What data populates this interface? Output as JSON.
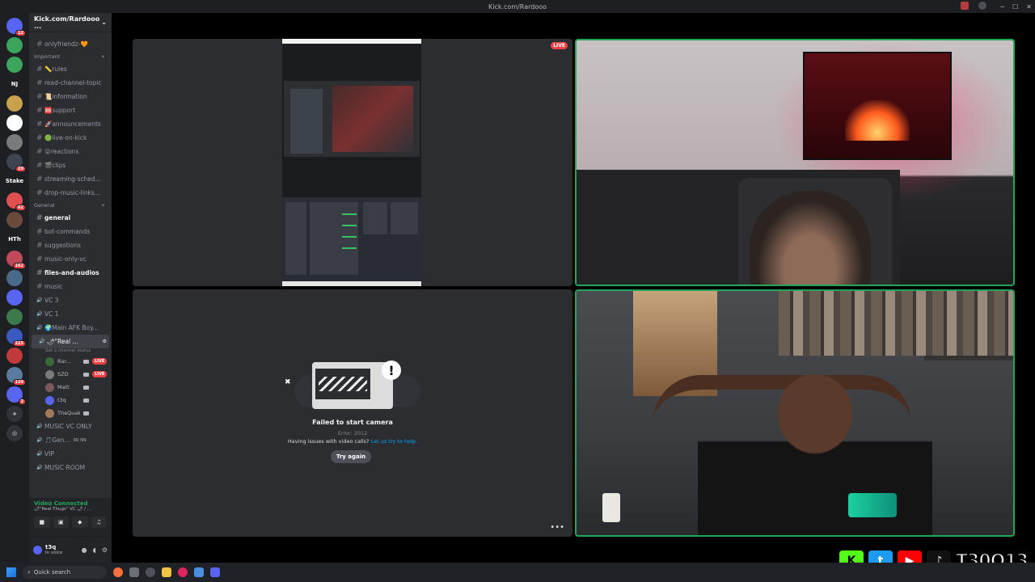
{
  "window": {
    "title": "Kick.com/Rardooo"
  },
  "servers": [
    {
      "label": "",
      "badge": "12",
      "color": "#5865f2"
    },
    {
      "label": "",
      "badge": "",
      "color": "#3ba55c"
    },
    {
      "label": "",
      "badge": "",
      "color": "#3ba55c"
    },
    {
      "label": "NJ",
      "badge": "",
      "color": "#1e1f22"
    },
    {
      "label": "",
      "badge": "",
      "color": "#c9a14a"
    },
    {
      "label": "",
      "badge": "",
      "color": "#ffffff"
    },
    {
      "label": "",
      "badge": "",
      "color": "#7a7a7a"
    },
    {
      "label": "",
      "badge": "29",
      "color": "#3f4550"
    },
    {
      "label": "Stake",
      "badge": "",
      "color": "#1e1f22"
    },
    {
      "label": "",
      "badge": "62",
      "color": "#e05050"
    },
    {
      "label": "",
      "badge": "",
      "color": "#6a4b3a"
    },
    {
      "label": "HTh",
      "badge": "",
      "color": "#1e1f22"
    },
    {
      "label": "",
      "badge": "162",
      "color": "#c04a5a"
    },
    {
      "label": "",
      "badge": "",
      "color": "#4a6a8a"
    },
    {
      "label": "",
      "badge": "",
      "color": "#5865f2"
    },
    {
      "label": "",
      "badge": "",
      "color": "#3a7a4a"
    },
    {
      "label": "",
      "badge": "225",
      "color": "#3a5ac0"
    },
    {
      "label": "",
      "badge": "",
      "color": "#c03a3a"
    },
    {
      "label": "",
      "badge": "120",
      "color": "#5a7aa0"
    },
    {
      "label": "",
      "badge": "3",
      "color": "#5865f2"
    }
  ],
  "guild": {
    "name": "Kick.com/Rardooo ...",
    "channels_top": [
      {
        "name": "onlyfriendz-🧡",
        "unread": false
      }
    ],
    "category_important": "Important",
    "channels_important": [
      {
        "name": "📏rules",
        "unread": false
      },
      {
        "name": "read-channel-topic",
        "unread": false
      },
      {
        "name": "📜information",
        "unread": false
      },
      {
        "name": "🆘support",
        "unread": false
      },
      {
        "name": "🚀announcements",
        "unread": false
      },
      {
        "name": "🟢live-on-kick",
        "unread": false
      },
      {
        "name": "😮reactions",
        "unread": false
      },
      {
        "name": "🎬clips",
        "unread": false
      },
      {
        "name": "streaming-sched...",
        "unread": false
      },
      {
        "name": "drop-music-links...",
        "unread": false
      }
    ],
    "category_general": "General",
    "channels_general": [
      {
        "name": "general",
        "unread": true
      },
      {
        "name": "bot-commands",
        "unread": false
      },
      {
        "name": "suggestions",
        "unread": false
      },
      {
        "name": "music-only-vc",
        "unread": false
      },
      {
        "name": "files-and-audios",
        "unread": true
      },
      {
        "name": "music",
        "unread": false
      }
    ],
    "voice_channels": [
      {
        "name": "VC 3"
      },
      {
        "name": "VC 1"
      },
      {
        "name": "🌍Main AFK Boy..."
      }
    ],
    "active_vc": {
      "name": "🌶\"Real ...",
      "status": "Set a channel status",
      "users": [
        {
          "name": "Rar...",
          "live": "LIVE",
          "color": "#3a6a3a"
        },
        {
          "name": "SZD",
          "live": "LIVE",
          "color": "#7a7a7a"
        },
        {
          "name": "Matt",
          "live": "",
          "color": "#7a5a5a"
        },
        {
          "name": "t3q",
          "live": "",
          "color": "#5865f2"
        },
        {
          "name": "TheQuakeM...",
          "live": "",
          "color": "#a07a5a"
        }
      ]
    },
    "voice_channels_after": [
      {
        "name": "MUSIC VC ONLY"
      },
      {
        "name": "🎵Gen...",
        "counts": "00 /99"
      },
      {
        "name": "VIP"
      },
      {
        "name": "MUSIC ROOM"
      }
    ]
  },
  "voice_bar": {
    "connected": "Video Connected",
    "channel": "🌶\"Real Thugs\" VC 🌶 / ..."
  },
  "user_bar": {
    "name": "t3q",
    "status": "In voice"
  },
  "stage": {
    "live_tag": "LIVE",
    "failed": {
      "title": "Failed to start camera",
      "error": "Error: 2012",
      "help_prefix": "Having issues with video calls?",
      "help_link": "Let us try to help.",
      "button": "Try again"
    }
  },
  "taskbar": {
    "search": "Quick search"
  },
  "overlay": {
    "handle": "T30Q13"
  },
  "colors": {
    "accent": "#5865f2",
    "speaking": "#23a55a",
    "live": "#ed4245",
    "link": "#00a8fc"
  }
}
